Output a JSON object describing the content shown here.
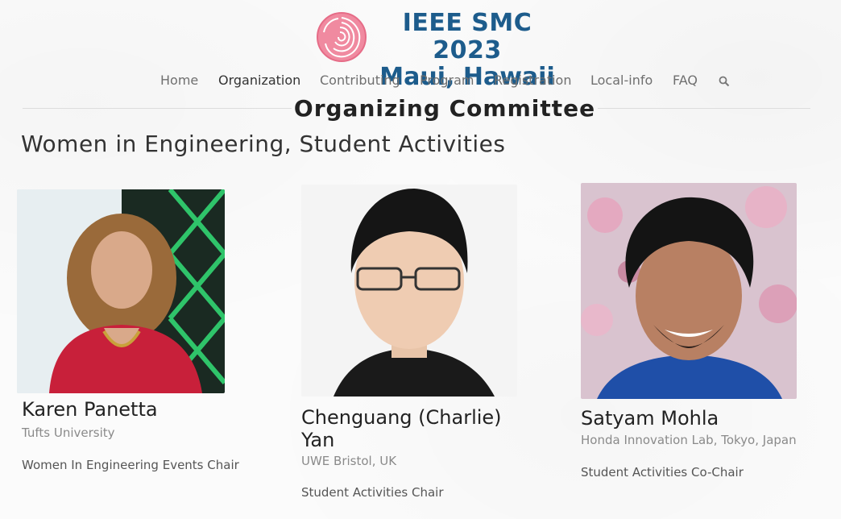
{
  "header": {
    "brand_line1": "IEEE SMC 2023",
    "brand_line2": "Maui, Hawaii",
    "logo_icon": "rose-flower-icon",
    "brand_color": "#1d5c8c",
    "logo_color": "#ef7f97"
  },
  "nav": {
    "items": [
      {
        "label": "Home",
        "active": false
      },
      {
        "label": "Organization",
        "active": true
      },
      {
        "label": "Contributing",
        "active": false
      },
      {
        "label": "Program",
        "active": false
      },
      {
        "label": "Registration",
        "active": false
      },
      {
        "label": "Local-info",
        "active": false
      },
      {
        "label": "FAQ",
        "active": false
      }
    ],
    "search_icon": "search-icon"
  },
  "page": {
    "title": "Organizing Committee",
    "section_title": "Women in Engineering, Student Activities"
  },
  "members": [
    {
      "name": "Karen Panetta",
      "affiliation": "Tufts University",
      "role": "Women In Engineering Events Chair"
    },
    {
      "name": "Chenguang (Charlie) Yan",
      "affiliation": "UWE Bristol, UK",
      "role": "Student Activities Chair"
    },
    {
      "name": "Satyam Mohla",
      "affiliation": "Honda Innovation Lab, Tokyo, Japan",
      "role": "Student Activities Co-Chair"
    }
  ]
}
